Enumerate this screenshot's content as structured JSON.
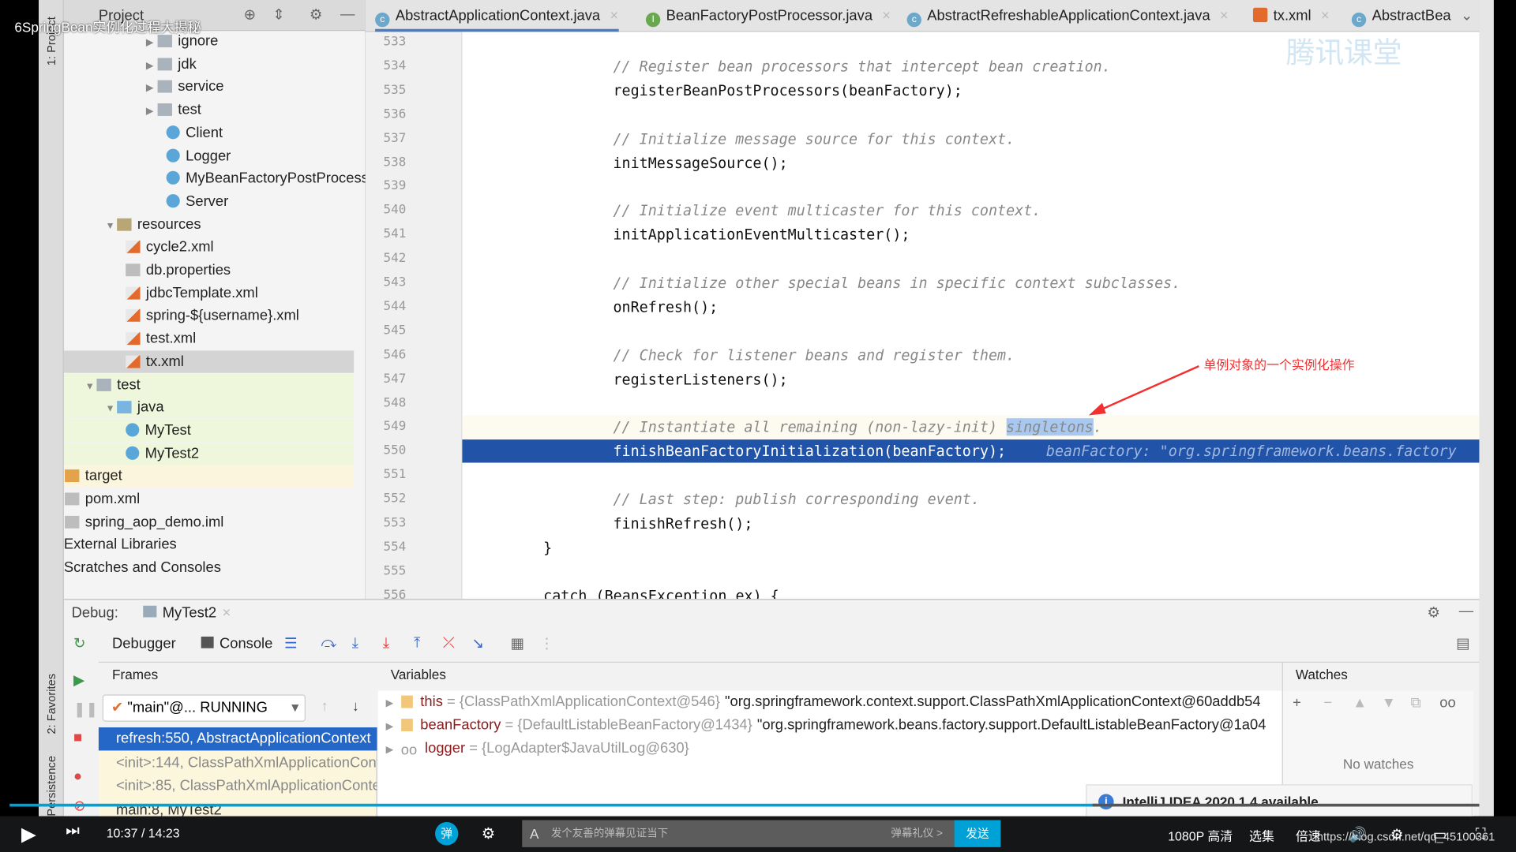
{
  "video_title": "6SpringBean实例化过程大揭秘",
  "sidebar_labels": {
    "project": "1: Project",
    "favorites": "2: Favorites",
    "persistence": "Persistence"
  },
  "project_panel": {
    "title": "Project",
    "items": [
      {
        "label": "ignore",
        "type": "folder",
        "depth": 3,
        "expandable": true
      },
      {
        "label": "jdk",
        "type": "folder",
        "depth": 3,
        "expandable": true
      },
      {
        "label": "service",
        "type": "folder",
        "depth": 3,
        "expandable": true
      },
      {
        "label": "test",
        "type": "folder",
        "depth": 3,
        "expandable": true
      },
      {
        "label": "Client",
        "type": "class",
        "depth": 4
      },
      {
        "label": "Logger",
        "type": "class",
        "depth": 4
      },
      {
        "label": "MyBeanFactoryPostProcessor",
        "type": "class",
        "depth": 4
      },
      {
        "label": "Server",
        "type": "class",
        "depth": 4
      },
      {
        "label": "resources",
        "type": "res",
        "depth": 1,
        "expanded": true
      },
      {
        "label": "cycle2.xml",
        "type": "xml",
        "depth": 2
      },
      {
        "label": "db.properties",
        "type": "prop",
        "depth": 2
      },
      {
        "label": "jdbcTemplate.xml",
        "type": "xml",
        "depth": 2
      },
      {
        "label": "spring-${username}.xml",
        "type": "xml",
        "depth": 2
      },
      {
        "label": "test.xml",
        "type": "xml",
        "depth": 2
      },
      {
        "label": "tx.xml",
        "type": "xml",
        "depth": 2,
        "selected": true
      },
      {
        "label": "test",
        "type": "folder",
        "depth": 0,
        "expanded": true
      },
      {
        "label": "java",
        "type": "src",
        "depth": 1,
        "expanded": true
      },
      {
        "label": "MyTest",
        "type": "class",
        "depth": 2
      },
      {
        "label": "MyTest2",
        "type": "class",
        "depth": 2
      },
      {
        "label": "target",
        "type": "tgt",
        "depth": -1
      },
      {
        "label": "pom.xml",
        "type": "pom",
        "depth": -1
      },
      {
        "label": "spring_aop_demo.iml",
        "type": "prop",
        "depth": -1
      },
      {
        "label": "External Libraries",
        "type": "none",
        "depth": -2
      },
      {
        "label": "Scratches and Consoles",
        "type": "none",
        "depth": -2
      }
    ]
  },
  "tabs": [
    {
      "label": "AbstractApplicationContext.java",
      "icon": "C",
      "active": true
    },
    {
      "label": "BeanFactoryPostProcessor.java",
      "icon": "I"
    },
    {
      "label": "AbstractRefreshableApplicationContext.java",
      "icon": "C"
    },
    {
      "label": "tx.xml",
      "icon": "xml"
    },
    {
      "label": "AbstractBea",
      "icon": "C"
    }
  ],
  "watermark": "腾讯课堂",
  "code_lines": [
    {
      "n": "533",
      "text": "",
      "kind": "code"
    },
    {
      "n": "534",
      "text": "    // Register bean processors that intercept bean creation.",
      "kind": "cmt"
    },
    {
      "n": "535",
      "text": "    registerBeanPostProcessors(beanFactory);",
      "kind": "code"
    },
    {
      "n": "536",
      "text": "",
      "kind": "code"
    },
    {
      "n": "537",
      "text": "    // Initialize message source for this context.",
      "kind": "cmt"
    },
    {
      "n": "538",
      "text": "    initMessageSource();",
      "kind": "code"
    },
    {
      "n": "539",
      "text": "",
      "kind": "code"
    },
    {
      "n": "540",
      "text": "    // Initialize event multicaster for this context.",
      "kind": "cmt"
    },
    {
      "n": "541",
      "text": "    initApplicationEventMulticaster();",
      "kind": "code"
    },
    {
      "n": "542",
      "text": "",
      "kind": "code"
    },
    {
      "n": "543",
      "text": "    // Initialize other special beans in specific context subclasses.",
      "kind": "cmt"
    },
    {
      "n": "544",
      "text": "    onRefresh();",
      "kind": "code"
    },
    {
      "n": "545",
      "text": "",
      "kind": "code"
    },
    {
      "n": "546",
      "text": "    // Check for listener beans and register them.",
      "kind": "cmt"
    },
    {
      "n": "547",
      "text": "    registerListeners();",
      "kind": "code"
    },
    {
      "n": "548",
      "text": "",
      "kind": "code"
    },
    {
      "n": "549",
      "text": "    // Instantiate all remaining (non-lazy-init) ",
      "kind": "cmt",
      "highlight": "singletons",
      "after": "."
    },
    {
      "n": "550",
      "text": "    finishBeanFactoryInitialization(beanFactory);",
      "kind": "exec",
      "hint": "beanFactory: \"org.springframework.beans.factory"
    },
    {
      "n": "551",
      "text": "",
      "kind": "code"
    },
    {
      "n": "552",
      "text": "    // Last step: publish corresponding event.",
      "kind": "cmt"
    },
    {
      "n": "553",
      "text": "    finishRefresh();",
      "kind": "code"
    },
    {
      "n": "554",
      "text": "}",
      "kind": "code"
    },
    {
      "n": "555",
      "text": "",
      "kind": "code"
    },
    {
      "n": "556",
      "text": "catch (BeansException ex) {",
      "kind": "code"
    }
  ],
  "annotation": "单例对象的一个实例化操作",
  "debug": {
    "label": "Debug:",
    "session": "MyTest2",
    "tabs": {
      "debugger": "Debugger",
      "console": "Console"
    },
    "frames_header": "Frames",
    "variables_header": "Variables",
    "watches_header": "Watches",
    "thread": "\"main\"@... RUNNING",
    "frames": [
      {
        "label": "refresh:550, AbstractApplicationContext",
        "selected": true
      },
      {
        "label": "<init>:144, ClassPathXmlApplicationContext"
      },
      {
        "label": "<init>:85, ClassPathXmlApplicationContext"
      },
      {
        "label": "main:8, MyTest2"
      }
    ],
    "variables": [
      {
        "name": "this",
        "type": "{ClassPathXmlApplicationContext@546}",
        "value": "\"org.springframework.context.support.ClassPathXmlApplicationContext@60addb54"
      },
      {
        "name": "beanFactory",
        "type": "{DefaultListableBeanFactory@1434}",
        "value": "\"org.springframework.beans.factory.support.DefaultListableBeanFactory@1a04"
      },
      {
        "name": "logger",
        "type": "{LogAdapter$JavaUtilLog@630}",
        "value": ""
      }
    ],
    "no_watches": "No watches"
  },
  "notification": "IntelliJ IDEA 2020.1.4 available",
  "player": {
    "time": "10:37 / 14:23",
    "danmaku_placeholder": "发个友善的弹幕见证当下",
    "danmaku_etiquette": "弹幕礼仪 >",
    "send": "发送",
    "quality": "1080P 高清",
    "episodes": "选集",
    "speed": "倍速",
    "url_watermark": "https://blog.csdn.net/qq_45100361",
    "progress_percent": 74,
    "accent": "#00a1d6"
  }
}
